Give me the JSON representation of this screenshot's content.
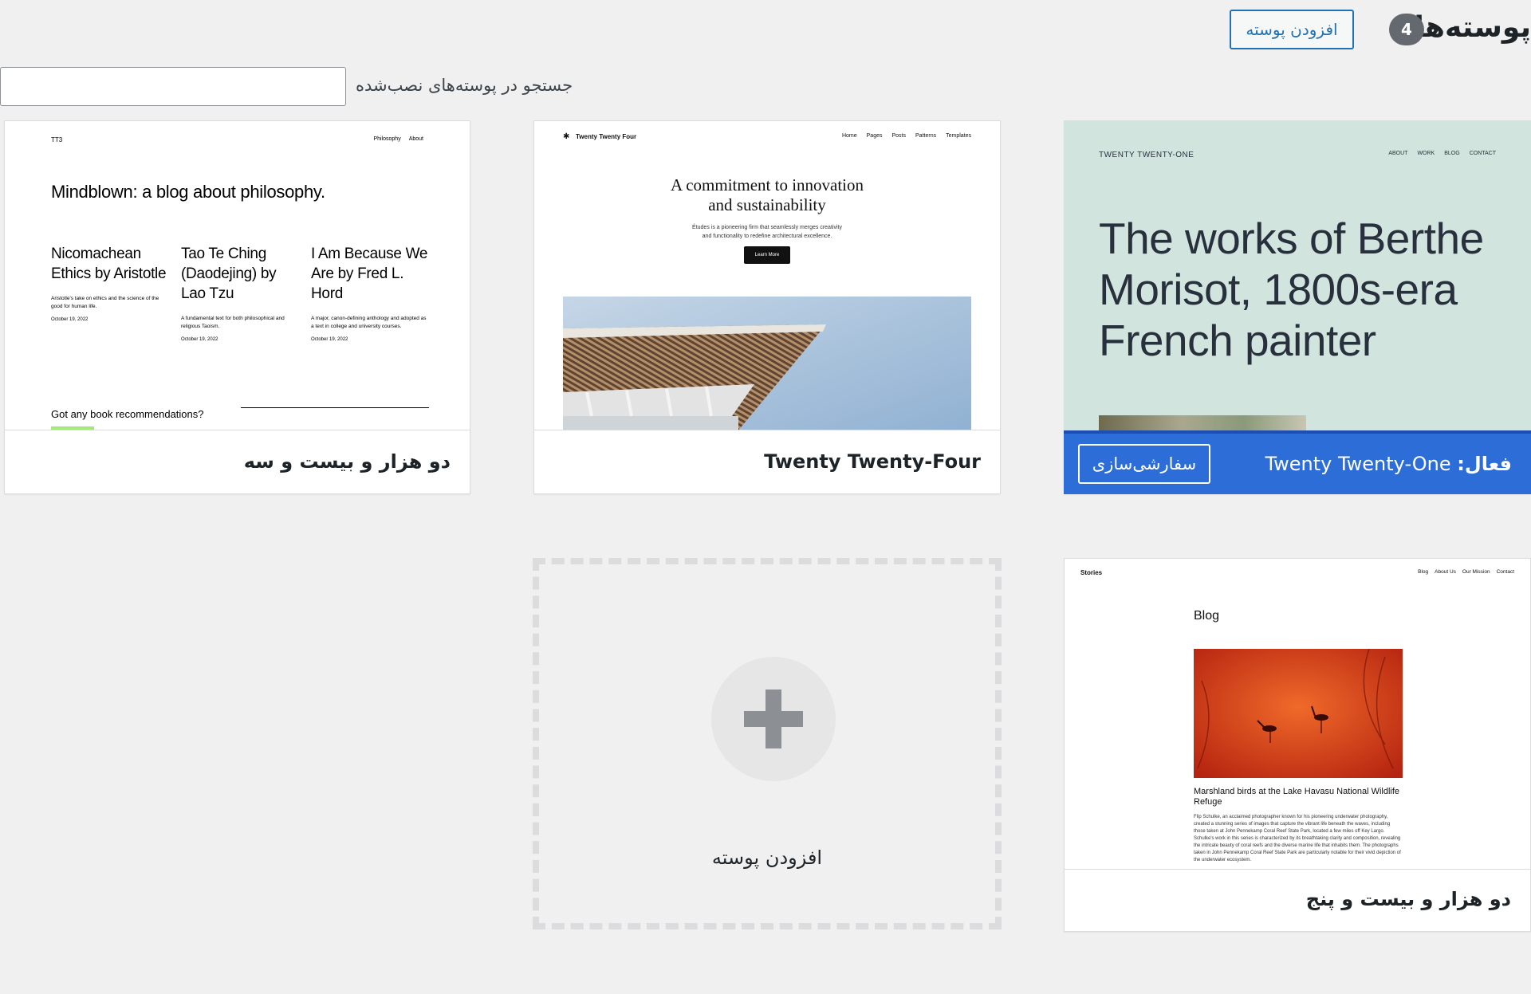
{
  "header": {
    "title": "پوسته‌ها",
    "count": "4",
    "add_new_label": "افزودن پوسته"
  },
  "search": {
    "label": "جستجو در پوسته‌های نصب‌شده",
    "value": "",
    "placeholder": ""
  },
  "themes": {
    "tt3": {
      "name": "دو هزار و بیست و سه",
      "preview": {
        "logo": "TT3",
        "nav": [
          "Philosophy",
          "About"
        ],
        "hero": "Mindblown: a blog about philosophy.",
        "posts": [
          {
            "title": "Nicomachean Ethics by Aristotle",
            "excerpt": "Aristotle's take on ethics and the science of the good for human life.",
            "date": "October 19, 2022"
          },
          {
            "title": "Tao Te Ching (Daodejing) by Lao Tzu",
            "excerpt": "A fundamental text for both philosophical and religious Taoism.",
            "date": "October 19, 2022"
          },
          {
            "title": "I Am Because We Are by Fred L. Hord",
            "excerpt": "A major, canon-defining anthology and adopted as a text in college and university courses.",
            "date": "October 19, 2022"
          }
        ],
        "question": "Got any book recommendations?"
      }
    },
    "tt4": {
      "name": "Twenty Twenty-Four",
      "preview": {
        "logo": "Twenty Twenty Four",
        "nav": [
          "Home",
          "Pages",
          "Posts",
          "Patterns",
          "Templates"
        ],
        "hero_line1": "A commitment to innovation",
        "hero_line2": "and sustainability",
        "sub_line1": "Études is a pioneering firm that seamlessly merges creativity",
        "sub_line2": "and functionality to redefine architectural excellence.",
        "button": "Learn More"
      }
    },
    "tt1": {
      "active_prefix": "فعال:",
      "name": "Twenty Twenty-One",
      "customize_label": "سفارشی‌سازی",
      "preview": {
        "logo": "TWENTY TWENTY-ONE",
        "nav": [
          "ABOUT",
          "WORK",
          "BLOG",
          "CONTACT"
        ],
        "hero": "The works of Berthe Morisot, 1800s-era French painter"
      }
    },
    "tt5": {
      "name": "دو هزار و بیست و پنج",
      "preview": {
        "logo": "Stories",
        "nav": [
          "Blog",
          "About Us",
          "Our Mission",
          "Contact"
        ],
        "heading": "Blog",
        "post_title": "Marshland birds at the Lake Havasu National Wildlife Refuge",
        "post_body": "Flip Schulke, an acclaimed photographer known for his pioneering underwater photography, created a stunning series of images that capture the vibrant life beneath the waves, including those taken at John Pennekamp Coral Reef State Park, located a few miles off Key Largo. Schulke's work in this series is characterized by its breathtaking clarity and composition, revealing the intricate beauty of coral reefs and the diverse marine life that inhabits them. The photographs taken in John Pennekamp Coral Reef State Park are particularly notable for their vivid depiction of the underwater ecosystem."
      }
    }
  },
  "add_new_tile": {
    "label": "افزودن پوسته"
  },
  "colors": {
    "accent": "#2271b1",
    "active_footer": "#2c6dd8",
    "tt1_background": "#d1e4dd",
    "tt5_photo": "#d8401a"
  }
}
